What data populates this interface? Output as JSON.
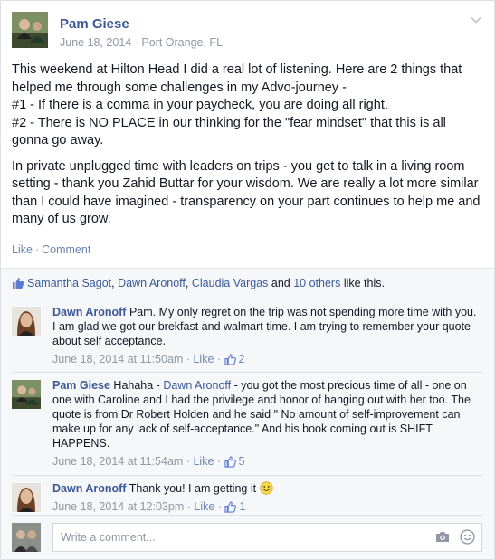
{
  "post": {
    "author": "Pam Giese",
    "date": "June 18, 2014",
    "location_sep": "·",
    "location": "Port Orange, FL",
    "paragraph1": "This weekend at Hilton Head I did a real lot of listening. Here are 2 things that helped me through some challenges in my Advo-journey -",
    "line2": "#1 - If there is a comma in your paycheck, you are doing all right.",
    "line3": "#2 - There is NO PLACE in our thinking for the \"fear mindset\" that this is all gonna go away.",
    "paragraph2": "In private unplugged time with leaders on trips - you get to talk in a living room setting - thank you Zahid Buttar for your wisdom. We are really a lot more similar than I could have imagined - transparency on your part continues to help me and many of us grow.",
    "like_label": "Like",
    "comment_label": "Comment",
    "sep": "·"
  },
  "likes": {
    "name1": "Samantha Sagot",
    "name2": "Dawn Aronoff",
    "name3": "Claudia Vargas",
    "and": " and ",
    "others": "10 others",
    "tail": " like this."
  },
  "comments": [
    {
      "author": "Dawn Aronoff",
      "text": " Pam. My only regret on the trip was not spending more time with you. I am glad we got our brekfast and walmart time. I am trying to remember your quote about self acceptance.",
      "time": "June 18, 2014 at 11:50am",
      "like": "Like",
      "count": "2"
    },
    {
      "author": "Pam Giese",
      "text_pre": " Hahaha - ",
      "mention": "Dawn Aronoff",
      "text_post": " - you got the most precious time of all - one on one with Caroline and I had the privilege and honor of hanging out with her too. The quote is from Dr Robert Holden and he said \" No amount of self-improvement can make up for any lack of self-acceptance.\" And his book coming out is SHIFT HAPPENS.",
      "time": "June 18, 2014 at 11:54am",
      "like": "Like",
      "count": "5"
    },
    {
      "author": "Dawn Aronoff",
      "text": " Thank you! I am getting it ",
      "time": "June 18, 2014 at 12:03pm",
      "like": "Like",
      "count": "1"
    }
  ],
  "composer": {
    "placeholder": "Write a comment..."
  },
  "colors": {
    "link": "#3b5998",
    "meta": "#9197a3",
    "action": "#6d84b4"
  }
}
